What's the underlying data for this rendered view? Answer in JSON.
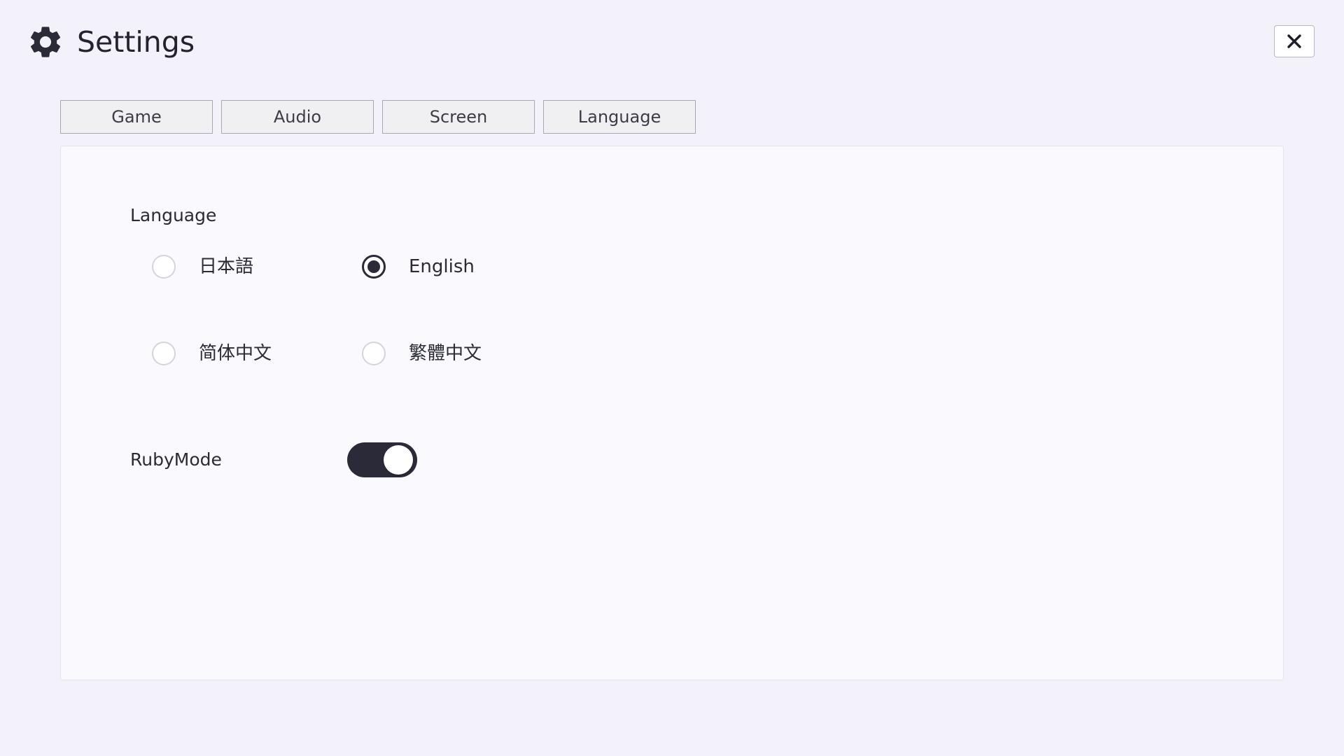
{
  "header": {
    "title": "Settings",
    "icon": "gear-icon",
    "close_icon": "close-icon"
  },
  "tabs": [
    {
      "label": "Game"
    },
    {
      "label": "Audio"
    },
    {
      "label": "Screen"
    },
    {
      "label": "Language"
    }
  ],
  "language_panel": {
    "section_label": "Language",
    "options": [
      {
        "label": "日本語",
        "selected": false
      },
      {
        "label": "English",
        "selected": true
      },
      {
        "label": "简体中文",
        "selected": false
      },
      {
        "label": "繁體中文",
        "selected": false
      }
    ],
    "ruby_mode": {
      "label": "RubyMode",
      "enabled": true
    }
  },
  "colors": {
    "background": "#f3f2fb",
    "panel": "#f9f9fe",
    "accent": "#2a2a38"
  }
}
